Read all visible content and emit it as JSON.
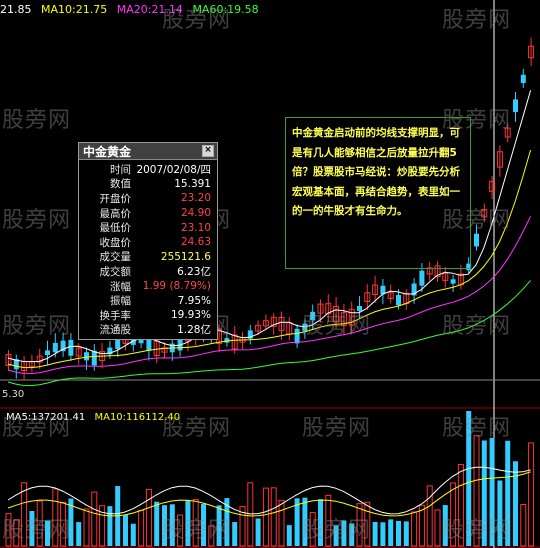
{
  "ma_header": {
    "price": "21.85",
    "ma10": "MA10:21.75",
    "ma20": "MA20:21.14",
    "ma60": "MA60:19.58"
  },
  "volume_header": {
    "ma5": "MA5:137201.41",
    "ma10": "MA10:116112.40"
  },
  "low_price_label": "5.30",
  "watermark": "股旁网",
  "info_panel": {
    "title": "中金黄金",
    "close_glyph": "×",
    "rows": [
      {
        "label": "时间",
        "value": "2007/02/08/四",
        "color": "#ffffff"
      },
      {
        "label": "数值",
        "value": "15.391",
        "color": "#ffffff"
      },
      {
        "label": "开盘价",
        "value": "23.20",
        "color": "#ff4444"
      },
      {
        "label": "最高价",
        "value": "24.90",
        "color": "#ff4444"
      },
      {
        "label": "最低价",
        "value": "23.10",
        "color": "#ff4444"
      },
      {
        "label": "收盘价",
        "value": "24.63",
        "color": "#ff4444"
      },
      {
        "label": "成交量",
        "value": "255121.6",
        "color": "#ffff55"
      },
      {
        "label": "成交额",
        "value": "6.23亿",
        "color": "#ffffff"
      },
      {
        "label": "涨幅",
        "value": "1.99 (8.79%)",
        "color": "#ff4444"
      },
      {
        "label": "振幅",
        "value": "7.95%",
        "color": "#ffffff"
      },
      {
        "label": "换手率",
        "value": "19.93%",
        "color": "#ffffff"
      },
      {
        "label": "流通股",
        "value": "1.28亿",
        "color": "#ffffff"
      }
    ]
  },
  "annotation": "中金黄金启动前的均线支撑明显，可是有几人能够相信之后放量拉升翻5倍？股票股市马经说：炒股要先分析宏观基本面，再结合趋势，表里如一的一的牛股才有生命力。",
  "colors": {
    "up": "#ff3333",
    "down": "#33ccff",
    "ma_price": "#ffffff",
    "ma10": "#ffff00",
    "ma20": "#ff33ff",
    "ma60": "#33ff33",
    "grid": "#a00000"
  }
}
